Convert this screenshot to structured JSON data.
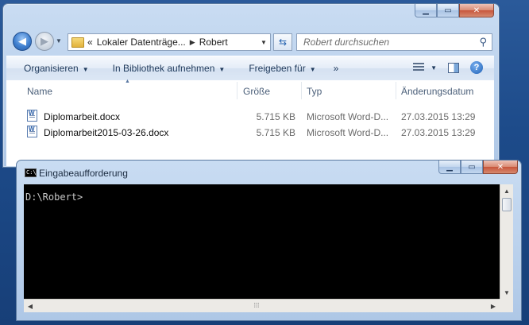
{
  "explorer": {
    "address": {
      "overflow": "«",
      "segments": [
        "Lokaler Datenträge...",
        "Robert"
      ]
    },
    "search_placeholder": "Robert durchsuchen",
    "toolbar": {
      "organize": "Organisieren",
      "include_library": "In Bibliothek aufnehmen",
      "share": "Freigeben für",
      "more": "»"
    },
    "columns": {
      "name": "Name",
      "size": "Größe",
      "type": "Typ",
      "date": "Änderungsdatum"
    },
    "files": [
      {
        "name": "Diplomarbeit.docx",
        "size": "5.715 KB",
        "type": "Microsoft Word-D...",
        "date": "27.03.2015 13:29"
      },
      {
        "name": "Diplomarbeit2015-03-26.docx",
        "size": "5.715 KB",
        "type": "Microsoft Word-D...",
        "date": "27.03.2015 13:29"
      }
    ]
  },
  "cmd": {
    "title": "Eingabeaufforderung",
    "prompt": "D:\\Robert>"
  },
  "icons": {
    "explorer_back": "back-arrow-icon",
    "explorer_forward": "forward-arrow-icon",
    "folder": "folder-icon",
    "refresh": "refresh-icon",
    "search": "magnifier-icon",
    "view": "view-options-icon",
    "preview_pane": "preview-pane-icon",
    "help": "help-icon",
    "word_doc": "word-document-icon",
    "cmd": "console-icon"
  },
  "colors": {
    "desktop": "#1d4b8a",
    "window_frame": "#b9d0ec",
    "console_bg": "#000000",
    "console_fg": "#c8c8c8",
    "close_button": "#c7553b"
  }
}
